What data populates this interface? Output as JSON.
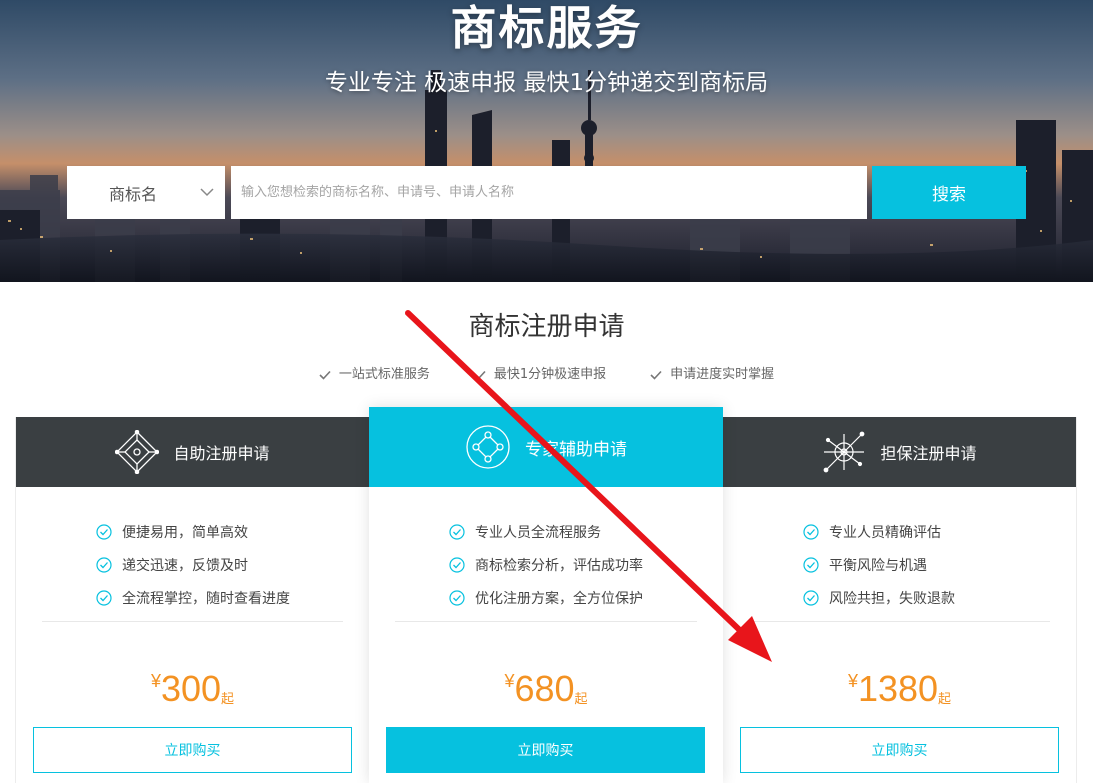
{
  "hero": {
    "title": "商标服务",
    "subtitle": "专业专注 极速申报 最快1分钟递交到商标局"
  },
  "search": {
    "type_label": "商标名",
    "placeholder": "输入您想检索的商标名称、申请号、申请人名称",
    "button_label": "搜索"
  },
  "section": {
    "title": "商标注册申请",
    "features": [
      "一站式标准服务",
      "最快1分钟极速申报",
      "申请进度实时掌握"
    ]
  },
  "cards": [
    {
      "title": "自助注册申请",
      "features": [
        "便捷易用，简单高效",
        "递交迅速，反馈及时",
        "全流程掌控，随时查看进度"
      ],
      "price": {
        "currency": "¥",
        "amount": "300",
        "suffix": "起"
      },
      "button_label": "立即购买"
    },
    {
      "title": "专家辅助申请",
      "features": [
        "专业人员全流程服务",
        "商标检索分析，评估成功率",
        "优化注册方案，全方位保护"
      ],
      "price": {
        "currency": "¥",
        "amount": "680",
        "suffix": "起"
      },
      "button_label": "立即购买"
    },
    {
      "title": "担保注册申请",
      "features": [
        "专业人员精确评估",
        "平衡风险与机遇",
        "风险共担，失败退款"
      ],
      "price": {
        "currency": "¥",
        "amount": "1380",
        "suffix": "起"
      },
      "button_label": "立即购买"
    }
  ],
  "colors": {
    "accent": "#06c1df",
    "price": "#f39223",
    "card_header_dark": "#3a3f42",
    "annotation_arrow": "#e8151b"
  },
  "icons": {
    "search_type": "chevron-down-icon",
    "section_feature": "check-icon",
    "card_feature": "circle-check-icon",
    "card_1": "diamond-network-icon",
    "card_2": "circle-nodes-icon",
    "card_3": "crossed-network-icon"
  }
}
